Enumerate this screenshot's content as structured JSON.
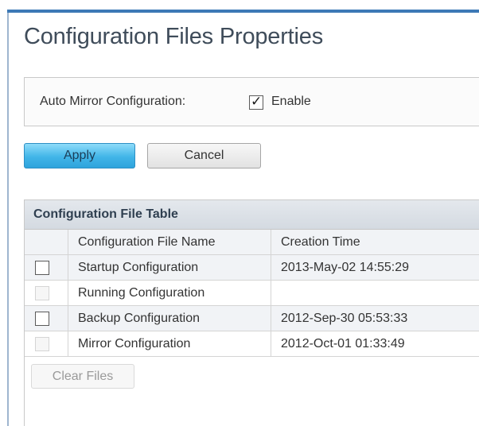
{
  "page": {
    "title": "Configuration Files Properties"
  },
  "auto_mirror": {
    "label": "Auto Mirror Configuration:",
    "checked": true,
    "option_label": "Enable"
  },
  "actions": {
    "apply_label": "Apply",
    "cancel_label": "Cancel"
  },
  "file_table": {
    "title": "Configuration File Table",
    "columns": [
      "Configuration File Name",
      "Creation Time"
    ],
    "rows": [
      {
        "name": "Startup Configuration",
        "time": "2013-May-02 14:55:29",
        "selectable": true
      },
      {
        "name": "Running Configuration",
        "time": "",
        "selectable": false
      },
      {
        "name": "Backup Configuration",
        "time": "2012-Sep-30 05:53:33",
        "selectable": true
      },
      {
        "name": "Mirror Configuration",
        "time": "2012-Oct-01 01:33:49",
        "selectable": false
      }
    ],
    "clear_label": "Clear Files"
  },
  "colors": {
    "accent": "#3d79b6",
    "apply_button": "#41b5e8",
    "table_header": "#d4dae1"
  }
}
